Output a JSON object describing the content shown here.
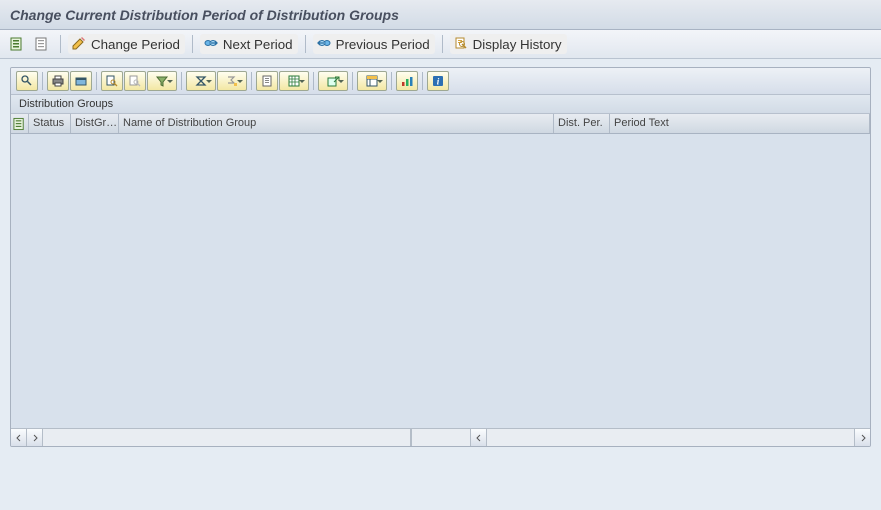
{
  "title": "Change Current Distribution Period of Distribution Groups",
  "toolbar": {
    "change_period": "Change Period",
    "next_period": "Next Period",
    "previous_period": "Previous Period",
    "display_history": "Display History"
  },
  "grid": {
    "panel_label": "Distribution Groups",
    "columns": {
      "status": "Status",
      "distgr": "DistGr…",
      "name": "Name of Distribution Group",
      "distper": "Dist. Per.",
      "period_text": "Period Text"
    }
  }
}
